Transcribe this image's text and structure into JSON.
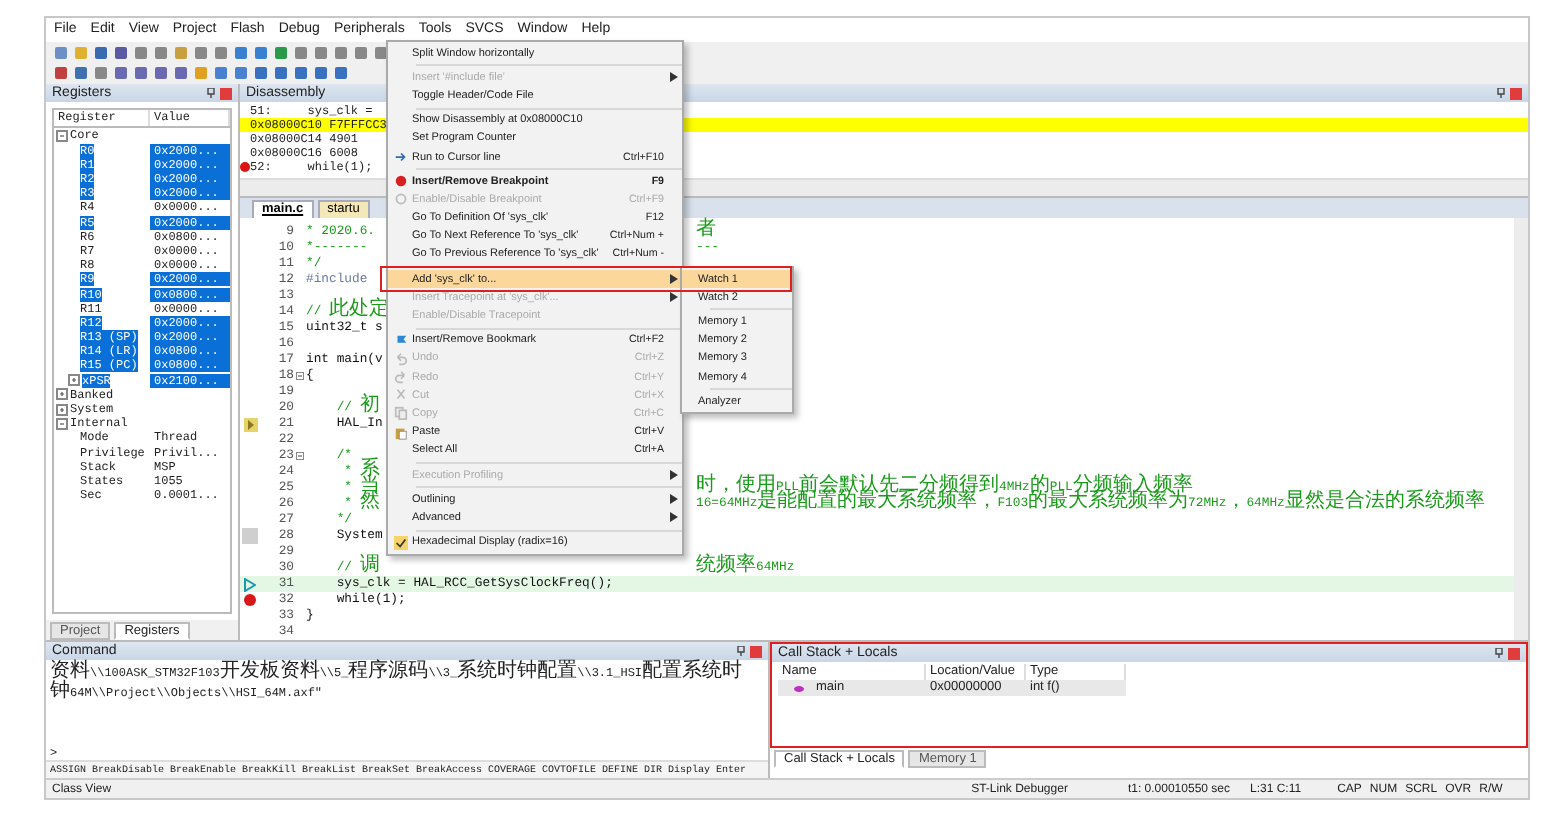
{
  "menu_bar": [
    "File",
    "Edit",
    "View",
    "Project",
    "Flash",
    "Debug",
    "Peripherals",
    "Tools",
    "SVCS",
    "Window",
    "Help"
  ],
  "registers": {
    "title": "Registers",
    "columns": [
      "Register",
      "Value"
    ],
    "tree": [
      {
        "name": "Core",
        "expanded": true,
        "selected": false,
        "children": [
          {
            "name": "R0",
            "value": "0x2000...",
            "selected": true
          },
          {
            "name": "R1",
            "value": "0x2000...",
            "selected": true
          },
          {
            "name": "R2",
            "value": "0x2000...",
            "selected": true
          },
          {
            "name": "R3",
            "value": "0x2000...",
            "selected": true
          },
          {
            "name": "R4",
            "value": "0x0000...",
            "selected": false
          },
          {
            "name": "R5",
            "value": "0x2000...",
            "selected": true
          },
          {
            "name": "R6",
            "value": "0x0800...",
            "selected": false
          },
          {
            "name": "R7",
            "value": "0x0000...",
            "selected": false
          },
          {
            "name": "R8",
            "value": "0x0000...",
            "selected": false
          },
          {
            "name": "R9",
            "value": "0x2000...",
            "selected": true
          },
          {
            "name": "R10",
            "value": "0x0800...",
            "selected": true
          },
          {
            "name": "R11",
            "value": "0x0000...",
            "selected": false
          },
          {
            "name": "R12",
            "value": "0x2000...",
            "selected": true
          },
          {
            "name": "R13 (SP)",
            "value": "0x2000...",
            "selected": true
          },
          {
            "name": "R14 (LR)",
            "value": "0x0800...",
            "selected": true
          },
          {
            "name": "R15 (PC)",
            "value": "0x0800...",
            "selected": true
          },
          {
            "name": "xPSR",
            "value": "0x2100...",
            "selected": true,
            "expanded": false
          }
        ]
      },
      {
        "name": "Banked",
        "expanded": false,
        "selected": false
      },
      {
        "name": "System",
        "expanded": false,
        "selected": false
      },
      {
        "name": "Internal",
        "expanded": true,
        "selected": false,
        "children": [
          {
            "name": "Mode",
            "value": "Thread",
            "selected": false
          },
          {
            "name": "Privilege",
            "value": "Privil...",
            "selected": false
          },
          {
            "name": "Stack",
            "value": "MSP",
            "selected": false
          },
          {
            "name": "States",
            "value": "1055",
            "selected": false
          },
          {
            "name": "Sec",
            "value": "0.0001...",
            "selected": false
          }
        ]
      }
    ],
    "tabs": [
      {
        "label": "Project",
        "selected": false
      },
      {
        "label": "Registers",
        "selected": true
      }
    ]
  },
  "disassembly": {
    "title": "Disassembly",
    "lines": [
      {
        "text": "51:     sys_clk =",
        "highlight": false,
        "breakpoint": false
      },
      {
        "text": "0x08000C10 F7FFFCC3",
        "highlight": true,
        "breakpoint": false
      },
      {
        "text": "0x08000C14 4901",
        "highlight": false,
        "breakpoint": false
      },
      {
        "text": "0x08000C16 6008",
        "highlight": false,
        "breakpoint": false
      },
      {
        "text": "52:     while(1);",
        "highlight": false,
        "breakpoint": true
      }
    ]
  },
  "editor": {
    "tabs": [
      {
        "label": "main.c",
        "selected": true
      },
      {
        "label": "startu",
        "selected": false
      }
    ],
    "lines": [
      {
        "n": "9",
        "text": "* 2020.6.",
        "tail": "者",
        "kind": "comment",
        "fold": false
      },
      {
        "n": "10",
        "text": "*-------",
        "tail": "---",
        "kind": "comment",
        "fold": false
      },
      {
        "n": "11",
        "text": "*/",
        "kind": "comment",
        "fold": false
      },
      {
        "n": "12",
        "text": "#include",
        "kind": "directive",
        "fold": false
      },
      {
        "n": "13",
        "fold": false
      },
      {
        "n": "14",
        "text": "// 此处定",
        "kind": "comment",
        "fold": false
      },
      {
        "n": "15",
        "text": "uint32_t s",
        "kind": "code",
        "fold": false
      },
      {
        "n": "16",
        "fold": false
      },
      {
        "n": "17",
        "text": "int main(v",
        "kind": "code",
        "fold": false
      },
      {
        "n": "18",
        "text": "{",
        "kind": "code",
        "fold": true
      },
      {
        "n": "19",
        "fold": false
      },
      {
        "n": "20",
        "text": "    // 初",
        "kind": "comment",
        "fold": false
      },
      {
        "n": "21",
        "text": "    HAL_In",
        "kind": "code",
        "fold": false,
        "gutter": {
          "kind": "bookmark"
        }
      },
      {
        "n": "22",
        "fold": false
      },
      {
        "n": "23",
        "text": "    /*",
        "kind": "comment",
        "fold": true
      },
      {
        "n": "24",
        "text": "     * 系",
        "kind": "comment",
        "fold": false
      },
      {
        "n": "25",
        "text": "     * 当",
        "tail": "时，使用PLL前会默认先二分频得到4MHz的PLL分频输入频率",
        "kind": "comment",
        "fold": false
      },
      {
        "n": "26",
        "text": "     * 然",
        "tail": "16=64MHz是能配置的最大系统频率，F103的最大系统频率为72MHz，64MHz显然是合法的系统频率",
        "kind": "comment",
        "fold": false
      },
      {
        "n": "27",
        "text": "    */",
        "kind": "comment",
        "fold": false
      },
      {
        "n": "28",
        "text": "    System",
        "kind": "code",
        "fold": false,
        "gutter": {
          "kind": "mark"
        }
      },
      {
        "n": "29",
        "fold": false
      },
      {
        "n": "30",
        "text": "    // 调",
        "tail": "统频率64MHz",
        "kind": "comment",
        "fold": false
      },
      {
        "n": "31",
        "text": "    sys_clk = HAL_RCC_GetSysClockFreq();",
        "kind": "code",
        "fold": false,
        "gutter": {
          "kind": "current"
        }
      },
      {
        "n": "32",
        "text": "    while(1);",
        "kind": "code",
        "fold": false,
        "gutter": {
          "kind": "breakpoint"
        }
      },
      {
        "n": "33",
        "text": "}",
        "kind": "code",
        "fold": false
      },
      {
        "n": "34",
        "fold": false
      }
    ]
  },
  "context_menu": {
    "items": [
      {
        "kind": "item",
        "label": "Split Window horizontally",
        "disabled": false,
        "selected": false,
        "checked": false
      },
      {
        "kind": "separator"
      },
      {
        "kind": "item",
        "label": "Insert '#include file'",
        "submenu": true,
        "disabled": true,
        "selected": false,
        "checked": false
      },
      {
        "kind": "item",
        "label": "Toggle Header/Code File",
        "disabled": false,
        "selected": false,
        "checked": false
      },
      {
        "kind": "separator"
      },
      {
        "kind": "item",
        "label": "Show Disassembly at 0x08000C10",
        "disabled": false,
        "selected": false,
        "checked": false
      },
      {
        "kind": "item",
        "label": "Set Program Counter",
        "disabled": false,
        "selected": false,
        "checked": false
      },
      {
        "kind": "run",
        "label": "Run to Cursor line",
        "shortcut": "Ctrl+F10",
        "disabled": false,
        "selected": false,
        "checked": false
      },
      {
        "kind": "separator"
      },
      {
        "kind": "breakpoint",
        "label": "Insert/Remove Breakpoint",
        "shortcut": "F9",
        "bold": true,
        "disabled": false,
        "selected": false,
        "checked": false
      },
      {
        "kind": "breakpoint-off",
        "label": "Enable/Disable Breakpoint",
        "shortcut": "Ctrl+F9",
        "disabled": true,
        "selected": false,
        "checked": false
      },
      {
        "kind": "item",
        "label": "Go To Definition Of 'sys_clk'",
        "shortcut": "F12",
        "disabled": false,
        "selected": false,
        "checked": false
      },
      {
        "kind": "item",
        "label": "Go To Next Reference To 'sys_clk'",
        "shortcut": "Ctrl+Num +",
        "disabled": false,
        "selected": false,
        "checked": false
      },
      {
        "kind": "item",
        "label": "Go To Previous Reference To 'sys_clk'",
        "shortcut": "Ctrl+Num -",
        "disabled": false,
        "selected": false,
        "checked": false
      },
      {
        "kind": "separator"
      },
      {
        "kind": "item",
        "label": "Add 'sys_clk' to...",
        "submenu": true,
        "disabled": false,
        "selected": true,
        "checked": false
      },
      {
        "kind": "item",
        "label": "Insert Tracepoint at 'sys_clk'...",
        "submenu": true,
        "disabled": true,
        "selected": false,
        "checked": false
      },
      {
        "kind": "item",
        "label": "Enable/Disable Tracepoint",
        "disabled": true,
        "selected": false,
        "checked": false
      },
      {
        "kind": "separator"
      },
      {
        "kind": "bookmark",
        "label": "Insert/Remove Bookmark",
        "shortcut": "Ctrl+F2",
        "disabled": false,
        "selected": false,
        "checked": false
      },
      {
        "kind": "undo",
        "label": "Undo",
        "shortcut": "Ctrl+Z",
        "disabled": true,
        "selected": false,
        "checked": false
      },
      {
        "kind": "redo",
        "label": "Redo",
        "shortcut": "Ctrl+Y",
        "disabled": true,
        "selected": false,
        "checked": false
      },
      {
        "kind": "cut",
        "label": "Cut",
        "shortcut": "Ctrl+X",
        "disabled": true,
        "selected": false,
        "checked": false
      },
      {
        "kind": "copy",
        "label": "Copy",
        "shortcut": "Ctrl+C",
        "disabled": true,
        "selected": false,
        "checked": false
      },
      {
        "kind": "paste",
        "label": "Paste",
        "shortcut": "Ctrl+V",
        "disabled": false,
        "selected": false,
        "checked": false
      },
      {
        "kind": "item",
        "label": "Select All",
        "shortcut": "Ctrl+A",
        "disabled": false,
        "selected": false,
        "checked": false
      },
      {
        "kind": "separator"
      },
      {
        "kind": "item",
        "label": "Execution Profiling",
        "submenu": true,
        "disabled": true,
        "selected": false,
        "checked": false
      },
      {
        "kind": "separator"
      },
      {
        "kind": "item",
        "label": "Outlining",
        "submenu": true,
        "disabled": false,
        "selected": false,
        "checked": false
      },
      {
        "kind": "item",
        "label": "Advanced",
        "submenu": true,
        "disabled": false,
        "selected": false,
        "checked": false
      },
      {
        "kind": "separator"
      },
      {
        "kind": "item",
        "label": "Hexadecimal Display (radix=16)",
        "disabled": false,
        "selected": false,
        "checked": true
      }
    ]
  },
  "submenu": {
    "items": [
      {
        "kind": "item",
        "label": "Watch 1",
        "selected": true
      },
      {
        "kind": "item",
        "label": "Watch 2",
        "selected": false
      },
      {
        "kind": "separator"
      },
      {
        "kind": "item",
        "label": "Memory 1",
        "selected": false
      },
      {
        "kind": "item",
        "label": "Memory 2",
        "selected": false
      },
      {
        "kind": "item",
        "label": "Memory 3",
        "selected": false
      },
      {
        "kind": "item",
        "label": "Memory 4",
        "selected": false
      },
      {
        "kind": "separator"
      },
      {
        "kind": "item",
        "label": "Analyzer",
        "selected": false
      }
    ]
  },
  "command": {
    "title": "Command",
    "output": "资料\\\\100ASK_STM32F103开发板资料\\\\5_程序源码\\\\3_系统时钟配置\\\\3.1_HSI配置系统时钟64M\\\\Project\\\\Objects\\\\HSI_64M.axf\"",
    "prompt": ">",
    "help": "ASSIGN BreakDisable BreakEnable BreakKill BreakList BreakSet BreakAccess COVERAGE COVTOFILE DEFINE DIR Display Enter"
  },
  "call_stack": {
    "title": "Call Stack + Locals",
    "columns": [
      "Name",
      "Location/Value",
      "Type"
    ],
    "rows": [
      [
        "main",
        "0x00000000",
        "int f()"
      ]
    ],
    "tabs": [
      {
        "label": "Call Stack + Locals",
        "selected": true
      },
      {
        "label": "Memory 1",
        "selected": false
      }
    ]
  },
  "status_bar": [
    "Class View",
    "ST-Link Debugger",
    "t1: 0.00010550 sec",
    "L:31 C:11",
    "CAP",
    "NUM",
    "SCRL",
    "OVR",
    "R/W"
  ]
}
